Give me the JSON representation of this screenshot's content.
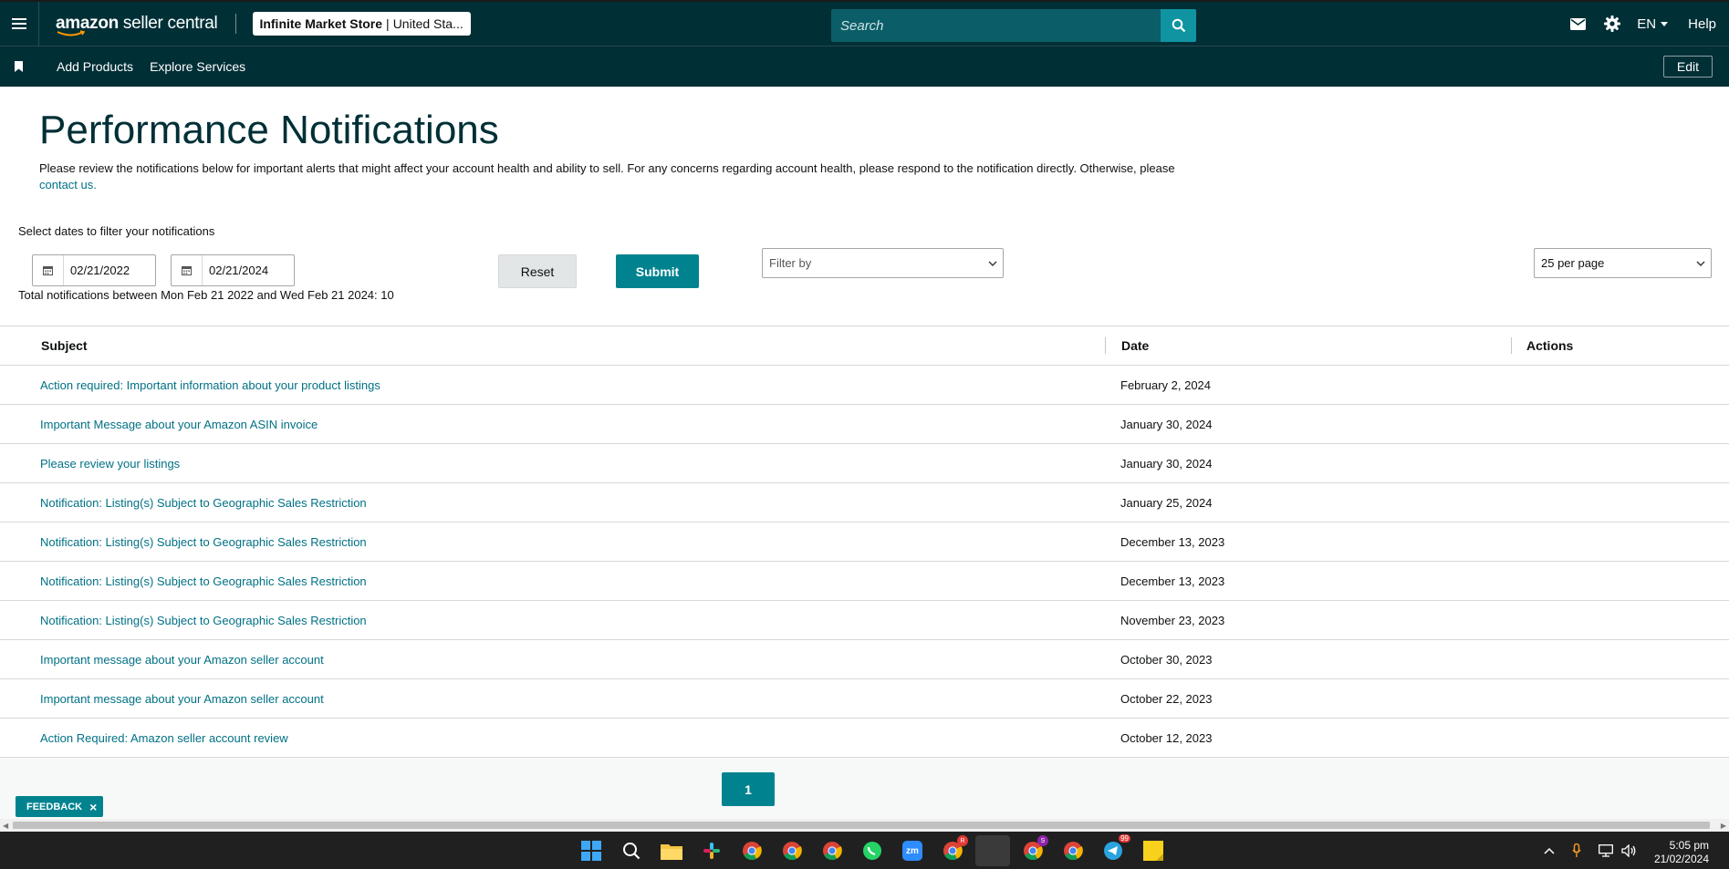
{
  "topbar": {
    "logo_main": "amazon",
    "logo_sub": " seller central",
    "store_name": "Infinite Market Store",
    "store_separator": "|",
    "store_region": "United Sta...",
    "search_placeholder": "Search",
    "language": "EN",
    "help": "Help"
  },
  "navbar": {
    "links": [
      "Add Products",
      "Explore Services"
    ],
    "edit": "Edit"
  },
  "page": {
    "title": "Performance Notifications",
    "description": "Please review the notifications below for important alerts that might affect your account health and ability to sell. For any concerns regarding account health, please respond to the notification directly. Otherwise, please ",
    "contact_link": "contact us.",
    "filter_label": "Select dates to filter your notifications",
    "date_from": "02/21/2022",
    "date_to": "02/21/2024",
    "total_text": "Total notifications between Mon Feb 21 2022 and Wed Feb 21 2024: 10",
    "reset": "Reset",
    "submit": "Submit",
    "filter_placeholder": "Filter by",
    "per_page": "25 per page"
  },
  "table": {
    "headers": {
      "subject": "Subject",
      "date": "Date",
      "actions": "Actions"
    },
    "rows": [
      {
        "subject": "Action required: Important information about your product listings",
        "date": "February 2, 2024"
      },
      {
        "subject": "Important Message about your Amazon ASIN invoice",
        "date": "January 30, 2024"
      },
      {
        "subject": "Please review your listings",
        "date": "January 30, 2024"
      },
      {
        "subject": "Notification: Listing(s) Subject to Geographic Sales Restriction",
        "date": "January 25, 2024"
      },
      {
        "subject": "Notification: Listing(s) Subject to Geographic Sales Restriction",
        "date": "December 13, 2023"
      },
      {
        "subject": "Notification: Listing(s) Subject to Geographic Sales Restriction",
        "date": "December 13, 2023"
      },
      {
        "subject": "Notification: Listing(s) Subject to Geographic Sales Restriction",
        "date": "November 23, 2023"
      },
      {
        "subject": "Important message about your Amazon seller account",
        "date": "October 30, 2023"
      },
      {
        "subject": "Important message about your Amazon seller account",
        "date": "October 22, 2023"
      },
      {
        "subject": "Action Required: Amazon seller account review",
        "date": "October 12, 2023"
      }
    ]
  },
  "pagination": {
    "current_page": "1"
  },
  "feedback": {
    "label": "FEEDBACK",
    "close": "×"
  },
  "taskbar": {
    "time": "5:05 pm",
    "date": "21/02/2024",
    "zoom_label": "zm",
    "badges": {
      "chrome_r": "R",
      "chrome_t": "T",
      "chrome_s": "S",
      "telegram": "99"
    }
  },
  "colors": {
    "header_bg": "#002f36",
    "accent_teal": "#00838f",
    "link": "#007185"
  }
}
